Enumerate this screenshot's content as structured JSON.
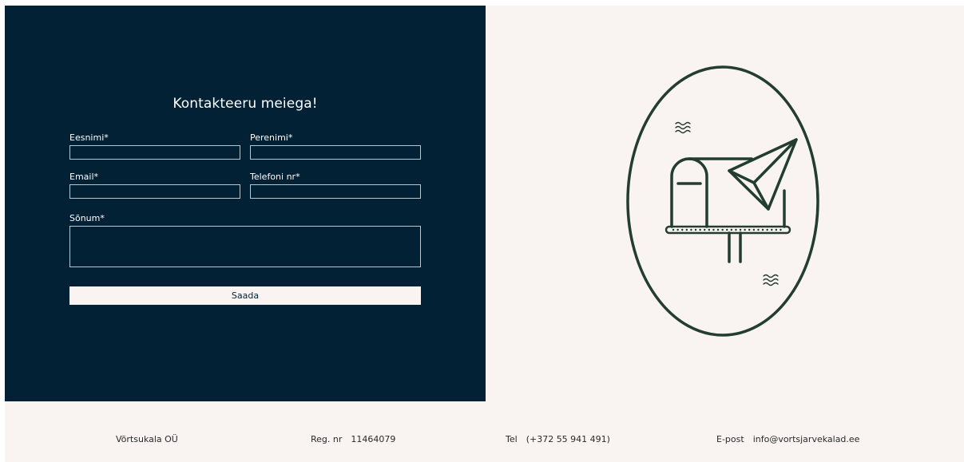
{
  "form": {
    "title": "Kontakteeru meiega!",
    "first_name_label": "Eesnimi*",
    "last_name_label": "Perenimi*",
    "email_label": "Email*",
    "phone_label": "Telefoni nr*",
    "message_label": "Sõnum*",
    "first_name_value": "",
    "last_name_value": "",
    "email_value": "",
    "phone_value": "",
    "message_value": "",
    "submit_label": "Saada"
  },
  "illustration": {
    "icon": "mailbox-paper-plane-icon"
  },
  "footer": {
    "company": "Võrtsukala OÜ",
    "reg_label": "Reg. nr",
    "reg_value": "11464079",
    "tel_label": "Tel",
    "tel_value": "(+372 55 941 491)",
    "email_label": "E-post",
    "email_value": "info@vortsjarvekalad.ee"
  },
  "colors": {
    "panel": "#022135",
    "background": "#f9f4f1",
    "illustration": "#233d2e"
  }
}
